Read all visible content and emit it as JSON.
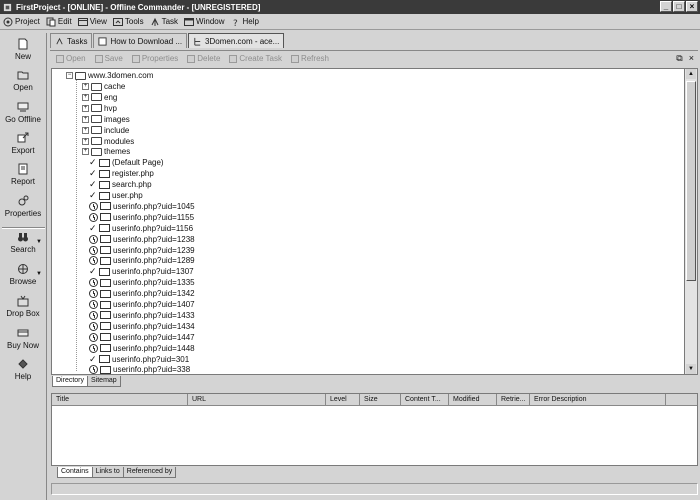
{
  "window": {
    "title": "FirstProject - [ONLINE] - Offline Commander - [UNREGISTERED]",
    "controls": [
      "_",
      "□",
      "×"
    ]
  },
  "menu": [
    "Project",
    "Edit",
    "View",
    "Tools",
    "Task",
    "Window",
    "Help"
  ],
  "sidebar": [
    {
      "label": "New",
      "icon": "new-document-icon"
    },
    {
      "label": "Open",
      "icon": "open-folder-icon"
    },
    {
      "label": "Go Offline",
      "icon": "go-offline-icon"
    },
    {
      "label": "Export",
      "icon": "export-icon"
    },
    {
      "label": "Report",
      "icon": "report-icon"
    },
    {
      "label": "Properties",
      "icon": "properties-icon"
    },
    {
      "label": "Search",
      "icon": "binoculars-icon"
    },
    {
      "label": "Browse",
      "icon": "browse-icon"
    },
    {
      "label": "Drop Box",
      "icon": "drop-box-icon"
    },
    {
      "label": "Buy Now",
      "icon": "buy-now-icon"
    },
    {
      "label": "Help",
      "icon": "help-icon"
    }
  ],
  "tabs": [
    "Tasks",
    "How to Download ...",
    "3Domen.com - ace..."
  ],
  "doc_toolbar": [
    "Open",
    "Save",
    "Properties",
    "Delete",
    "Create Task",
    "Refresh"
  ],
  "doc_window_controls": [
    "⧉",
    "×"
  ],
  "tree": {
    "root": "www.3domen.com",
    "folders": [
      "cache",
      "eng",
      "hvp",
      "images",
      "include",
      "modules",
      "themes"
    ],
    "pages": [
      {
        "name": "(Default Page)",
        "status": "done"
      },
      {
        "name": "register.php",
        "status": "done"
      },
      {
        "name": "search.php",
        "status": "done"
      },
      {
        "name": "user.php",
        "status": "done"
      },
      {
        "name": "userinfo.php?uid=1045",
        "status": "pending"
      },
      {
        "name": "userinfo.php?uid=1155",
        "status": "pending"
      },
      {
        "name": "userinfo.php?uid=1156",
        "status": "done"
      },
      {
        "name": "userinfo.php?uid=1238",
        "status": "pending"
      },
      {
        "name": "userinfo.php?uid=1239",
        "status": "pending"
      },
      {
        "name": "userinfo.php?uid=1289",
        "status": "pending"
      },
      {
        "name": "userinfo.php?uid=1307",
        "status": "done"
      },
      {
        "name": "userinfo.php?uid=1335",
        "status": "pending"
      },
      {
        "name": "userinfo.php?uid=1342",
        "status": "pending"
      },
      {
        "name": "userinfo.php?uid=1407",
        "status": "pending"
      },
      {
        "name": "userinfo.php?uid=1433",
        "status": "pending"
      },
      {
        "name": "userinfo.php?uid=1434",
        "status": "pending"
      },
      {
        "name": "userinfo.php?uid=1447",
        "status": "pending"
      },
      {
        "name": "userinfo.php?uid=1448",
        "status": "pending"
      },
      {
        "name": "userinfo.php?uid=301",
        "status": "done"
      },
      {
        "name": "userinfo.php?uid=338",
        "status": "pending"
      }
    ]
  },
  "tree_tabs": [
    "Directory",
    "Sitemap"
  ],
  "columns": [
    "Title",
    "URL",
    "Level",
    "Size",
    "Content T...",
    "Modified",
    "Retrie...",
    "Error Description"
  ],
  "bottom_tabs": [
    "Contains",
    "Links to",
    "Referenced by"
  ]
}
